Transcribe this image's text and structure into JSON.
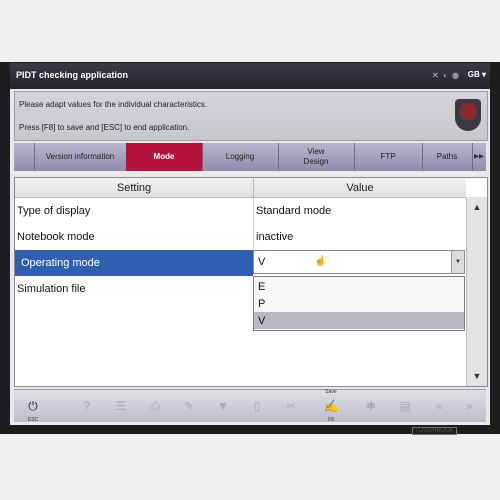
{
  "app": {
    "title": "PIDT checking application",
    "lang": "GB ▾",
    "status_icons": "✕ ◐ ◉"
  },
  "info": {
    "line1": "Please adapt values for the individual characteristics.",
    "line2": "Press [F8] to save and [ESC] to end application."
  },
  "tabs": [
    {
      "label": "Version information"
    },
    {
      "label": "Mode"
    },
    {
      "label": "Logging"
    },
    {
      "label1": "View",
      "label2": "Design"
    },
    {
      "label": "FTP"
    },
    {
      "label": "Paths"
    },
    {
      "label": "▸▸"
    }
  ],
  "table": {
    "headers": [
      "Setting",
      "Value"
    ],
    "rows": [
      {
        "setting": "Type of display",
        "value": "Standard mode"
      },
      {
        "setting": "Notebook mode",
        "value": "inactive"
      },
      {
        "setting": "Operating mode",
        "value": "V"
      },
      {
        "setting": "Simulation file",
        "value": ""
      }
    ],
    "dropdown_options": [
      "E",
      "P",
      "V"
    ]
  },
  "toolbar": {
    "save_caption": "Save",
    "save_key": "F8",
    "power_key": "ESC"
  },
  "device": {
    "brand": "TOUGHBOOK"
  },
  "colors": {
    "active_tab": "#b3123d",
    "selection": "#2f5eb3"
  }
}
